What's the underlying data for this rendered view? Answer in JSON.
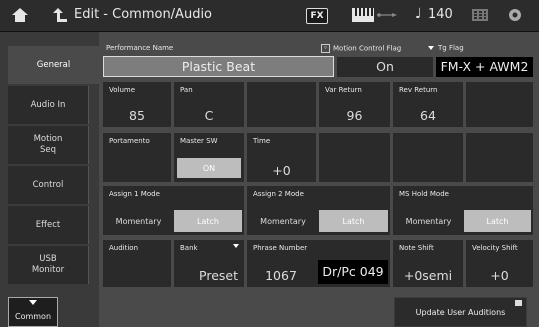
{
  "topbar": {
    "title": "Edit - Common/Audio",
    "fx_label": "FX",
    "note_glyph": "♩",
    "tempo": "140",
    "icons": [
      "home-icon",
      "back-icon",
      "keyboard-icon",
      "usb-icon",
      "grid-icon",
      "gear-icon"
    ]
  },
  "sidebar": {
    "tabs": [
      {
        "label": "General",
        "active": true
      },
      {
        "label": "Audio In",
        "active": false
      },
      {
        "label": "Motion Seq",
        "active": false
      },
      {
        "label": "Control",
        "active": false
      },
      {
        "label": "Effect",
        "active": false
      },
      {
        "label": "USB Monitor",
        "active": false
      }
    ],
    "common_label": "Common"
  },
  "main": {
    "performance_name_label": "Performance Name",
    "performance_name": "Plastic Beat",
    "motion_control_flag_label": "Motion Control Flag",
    "motion_control_flag": "On",
    "tg_flag_label": "Tg Flag",
    "tg_flag": "FM-X + AWM2",
    "volume_label": "Volume",
    "volume": "85",
    "pan_label": "Pan",
    "pan": "C",
    "var_return_label": "Var Return",
    "var_return": "96",
    "rev_return_label": "Rev Return",
    "rev_return": "64",
    "portamento_label": "Portamento",
    "master_sw_label": "Master SW",
    "master_sw": "ON",
    "time_label": "Time",
    "time": "+0",
    "assign1_label": "Assign 1 Mode",
    "assign2_label": "Assign 2 Mode",
    "ms_hold_label": "MS Hold Mode",
    "momentary": "Momentary",
    "latch": "Latch",
    "audition_label": "Audition",
    "bank_label": "Bank",
    "bank": "Preset",
    "phrase_number_label": "Phrase Number",
    "phrase_number": "1067",
    "phrase_name": "Dr/Pc 049",
    "note_shift_label": "Note Shift",
    "note_shift": "+0semi",
    "velocity_shift_label": "Velocity Shift",
    "velocity_shift": "+0"
  },
  "footer": {
    "update_user_auditions": "Update User Auditions"
  },
  "colors": {
    "background": "#4a4a4a",
    "cell": "#2a2a2a",
    "selected_segment": "#bdbdbd",
    "topbar": "#2c2c2c"
  }
}
